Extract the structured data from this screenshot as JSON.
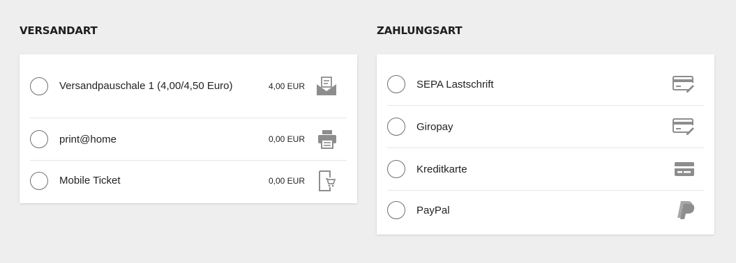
{
  "shipping": {
    "heading": "VERSANDART",
    "options": [
      {
        "label": "Versandpauschale 1 (4,00/4,50 Euro)",
        "price": "4,00 EUR",
        "icon": "mail-envelope-icon"
      },
      {
        "label": "print@home",
        "price": "0,00 EUR",
        "icon": "printer-icon"
      },
      {
        "label": "Mobile Ticket",
        "price": "0,00 EUR",
        "icon": "mobile-ticket-icon"
      }
    ]
  },
  "payment": {
    "heading": "ZAHLUNGSART",
    "options": [
      {
        "label": "SEPA Lastschrift",
        "icon": "sepa-card-icon"
      },
      {
        "label": "Giropay",
        "icon": "giropay-card-icon"
      },
      {
        "label": "Kreditkarte",
        "icon": "credit-card-icon"
      },
      {
        "label": "PayPal",
        "icon": "paypal-icon"
      }
    ]
  },
  "colors": {
    "background": "#eeeeee",
    "card": "#ffffff",
    "icon": "#8d8d8d"
  }
}
